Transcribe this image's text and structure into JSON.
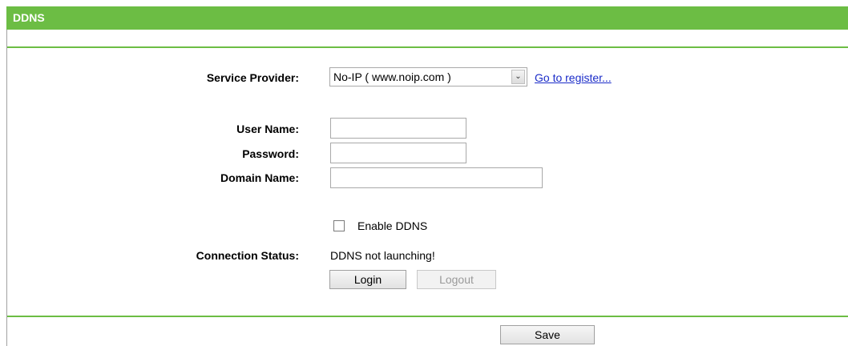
{
  "header": {
    "title": "DDNS"
  },
  "form": {
    "service_provider": {
      "label": "Service Provider:",
      "selected": "No-IP ( www.noip.com )",
      "arrow_glyph": "⌄",
      "register_link": "Go to register..."
    },
    "user_name": {
      "label": "User Name:",
      "value": ""
    },
    "password": {
      "label": "Password:",
      "value": ""
    },
    "domain_name": {
      "label": "Domain Name:",
      "value": ""
    },
    "enable_ddns": {
      "label": "Enable DDNS",
      "checked": false
    },
    "connection_status": {
      "label": "Connection Status:",
      "value": "DDNS not launching!"
    },
    "login_label": "Login",
    "logout_label": "Logout"
  },
  "footer": {
    "save_label": "Save"
  },
  "colors": {
    "accent": "#6cbd44",
    "link": "#1a2bc8"
  }
}
